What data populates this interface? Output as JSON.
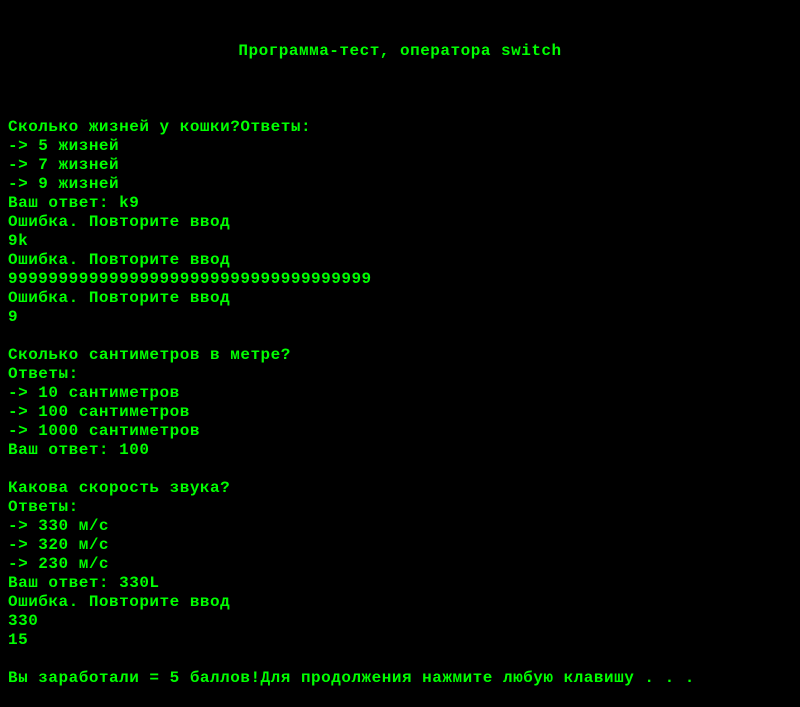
{
  "title": "Программа-тест, оператора switch",
  "lines": [
    "",
    "Сколько жизней у кошки?Ответы:",
    "-> 5 жизней",
    "-> 7 жизней",
    "-> 9 жизней",
    "Ваш ответ: k9",
    "Ошибка. Повторите ввод",
    "9k",
    "Ошибка. Повторите ввод",
    "999999999999999999999999999999999999",
    "Ошибка. Повторите ввод",
    "9",
    "",
    "Сколько сантиметров в метре?",
    "Ответы:",
    "-> 10 сантиметров",
    "-> 100 сантиметров",
    "-> 1000 сантиметров",
    "Ваш ответ: 100",
    "",
    "Какова скорость звука?",
    "Ответы:",
    "-> 330 м/с",
    "-> 320 м/с",
    "-> 230 м/с",
    "Ваш ответ: 330L",
    "Ошибка. Повторите ввод",
    "330",
    "15",
    "",
    "Вы заработали = 5 баллов!Для продолжения нажмите любую клавишу . . ."
  ]
}
